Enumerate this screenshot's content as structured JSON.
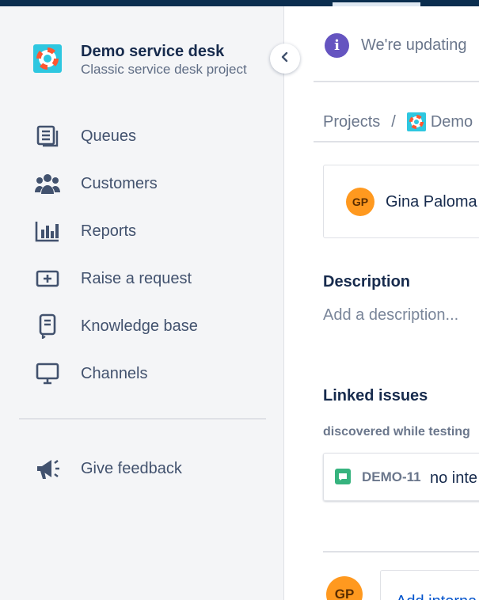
{
  "sidebar": {
    "project_name": "Demo service desk",
    "project_type": "Classic service desk project",
    "collapse_icon": "chevron-left-icon",
    "items": [
      {
        "label": "Queues",
        "icon": "queues-icon"
      },
      {
        "label": "Customers",
        "icon": "customers-icon"
      },
      {
        "label": "Reports",
        "icon": "reports-icon"
      },
      {
        "label": "Raise a request",
        "icon": "raise-request-icon"
      },
      {
        "label": "Knowledge base",
        "icon": "knowledge-base-icon"
      },
      {
        "label": "Channels",
        "icon": "channels-icon"
      }
    ],
    "feedback_label": "Give feedback",
    "feedback_icon": "megaphone-icon"
  },
  "main": {
    "info_banner": "We're updating",
    "breadcrumb": {
      "projects": "Projects",
      "separator": "/",
      "current": "Demo"
    },
    "reporter": {
      "initials": "GP",
      "name": "Gina Paloma"
    },
    "description": {
      "heading": "Description",
      "placeholder": "Add a description..."
    },
    "linked_issues": {
      "heading": "Linked issues",
      "link_type": "discovered while testing",
      "items": [
        {
          "key": "DEMO-11",
          "summary": "no inte"
        }
      ]
    },
    "comment": {
      "avatar_initials": "GP",
      "placeholder": "Add interna"
    }
  },
  "colors": {
    "topbar": "#0b2e4f",
    "sidebar_bg": "#f4f5f7",
    "info_purple": "#6554c0",
    "avatar_orange": "#ff991f",
    "project_logo": "#2ec7e0",
    "link_blue": "#0052cc",
    "issue_green": "#36b37e"
  }
}
